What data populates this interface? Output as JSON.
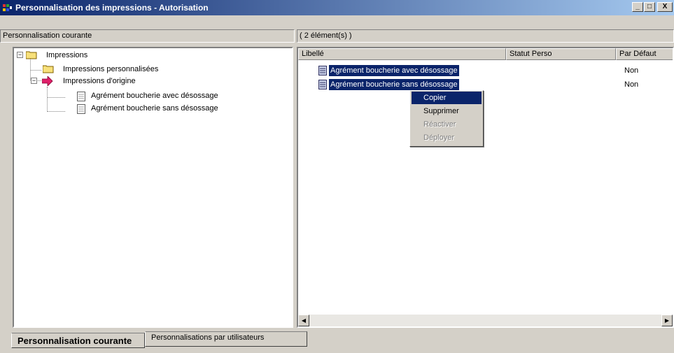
{
  "window": {
    "title": "Personnalisation des impressions - Autorisation",
    "controls": [
      "_",
      "□",
      "X"
    ]
  },
  "left_panel": {
    "header": "Personnalisation courante"
  },
  "right_panel": {
    "header": "( 2 élément(s) )"
  },
  "tree": {
    "root": "Impressions",
    "child_personnalisees": "Impressions personnalisées",
    "child_origine": "Impressions d'origine",
    "leaf_1": "Agrément boucherie avec désossage",
    "leaf_2": "Agrément boucherie sans désossage",
    "icons": [
      "folder-icon",
      "folder-icon",
      "arrow-icon",
      "document-icon",
      "document-icon"
    ]
  },
  "list": {
    "columns": [
      "Libellé",
      "Statut Perso",
      "Par Défaut"
    ],
    "rows": [
      {
        "libelle": "Agrément boucherie avec désossage",
        "statut": "",
        "defaut": "Non"
      },
      {
        "libelle": "Agrément boucherie sans désossage",
        "statut": "",
        "defaut": "Non"
      }
    ]
  },
  "context_menu": {
    "items": [
      "Copier",
      "Supprimer",
      "Réactiver",
      "Déployer"
    ],
    "active": "Copier",
    "disabled": [
      "Réactiver",
      "Déployer"
    ]
  },
  "tabs": [
    "Personnalisation courante",
    "Personnalisations par utilisateurs"
  ],
  "colors": {
    "selection": "#0a246a",
    "title_start": "#0a246a",
    "title_end": "#a6caf0",
    "face": "#d4d0c8"
  }
}
